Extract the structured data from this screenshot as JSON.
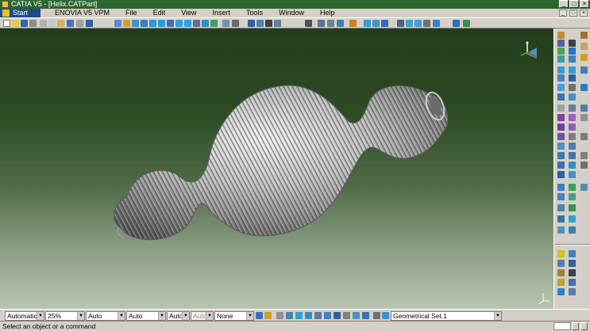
{
  "window": {
    "title": "CATIA V5 - [Helix.CATPart]",
    "controls": [
      "_",
      "□",
      "×"
    ]
  },
  "menubar": {
    "start": "Start",
    "items": [
      "ENOVIA V5 VPM",
      "File",
      "Edit",
      "View",
      "Insert",
      "Tools",
      "Window",
      "Help"
    ],
    "doc_controls": [
      "_",
      "□",
      "×"
    ]
  },
  "bottom_toolbar": {
    "combos": [
      {
        "name": "line-type-combo",
        "value": "Automatic"
      },
      {
        "name": "transparency-combo",
        "value": "25%"
      },
      {
        "name": "line-thickness-combo",
        "value": "Auto"
      },
      {
        "name": "point-style-combo",
        "value": "Auto"
      },
      {
        "name": "layer-auto-combo",
        "value": "Auto"
      },
      {
        "name": "auto-disabled-combo",
        "value": "Auto"
      },
      {
        "name": "layer-combo",
        "value": "None"
      }
    ],
    "geometrical_set": "Geometrical Set.1"
  },
  "status": {
    "message": "Select an object or a command"
  },
  "colors": {
    "title_bar": "#2a6130",
    "start_menu": "#1c4c8c",
    "viewport_top": "#243c1c",
    "viewport_bottom": "#b9c4b3",
    "helix": "#a9a9a9"
  },
  "icons": {
    "compass": "compass-icon",
    "axis": "axis-icon"
  }
}
